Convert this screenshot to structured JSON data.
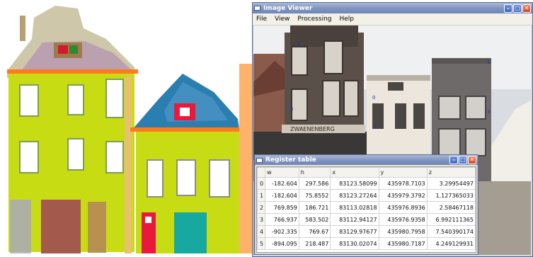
{
  "image_viewer": {
    "title": "Image Viewer",
    "menu": [
      "File",
      "View",
      "Processing",
      "Help"
    ],
    "window_buttons": [
      "minimize",
      "maximize",
      "close"
    ],
    "photo_text": {
      "shop_sign": "ZWAENENBERG",
      "point_labels": [
        "4",
        "5",
        "0",
        "2",
        "1",
        "3"
      ]
    }
  },
  "register_table": {
    "title": "Register table",
    "columns": [
      "w",
      "h",
      "x",
      "y",
      "z"
    ],
    "rows": [
      {
        "index": "0",
        "w": "-182.604",
        "h": "297.586",
        "x": "83123.58099",
        "y": "435978.7103",
        "z": "3.29954497"
      },
      {
        "index": "1",
        "w": "-182.604",
        "h": "75.8552",
        "x": "83123.27264",
        "y": "435979.3792",
        "z": "1.127365033"
      },
      {
        "index": "2",
        "w": "769.859",
        "h": "186.721",
        "x": "83113.02818",
        "y": "435976.8936",
        "z": "2.58467118"
      },
      {
        "index": "3",
        "w": "766.937",
        "h": "583.502",
        "x": "83112.94127",
        "y": "435976.9358",
        "z": "6.992111365"
      },
      {
        "index": "4",
        "w": "-902.335",
        "h": "769.67",
        "x": "83129.97677",
        "y": "435980.7958",
        "z": "7.540390174"
      },
      {
        "index": "5",
        "w": "-894.095",
        "h": "218.487",
        "x": "83130.02074",
        "y": "435980.7187",
        "z": "4.249129931"
      }
    ]
  },
  "colors": {
    "titlebar": "#7f93bf",
    "window_bg": "#ece9d8",
    "close_button": "#d0451f",
    "pointcloud_yellow": "#c8dc14",
    "pointcloud_orange": "#ff7a1a",
    "pointcloud_blue": "#2a7fb0",
    "pointcloud_red": "#e8193c",
    "pointcloud_teal": "#17a8a0"
  },
  "icons": [
    "app-window-icon",
    "minimize-icon",
    "maximize-icon",
    "close-icon"
  ]
}
